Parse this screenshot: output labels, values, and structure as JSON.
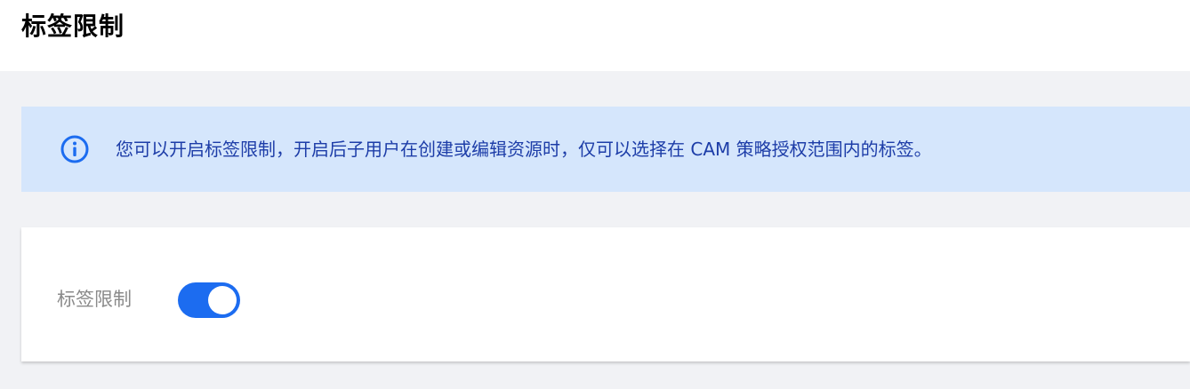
{
  "header": {
    "title": "标签限制"
  },
  "notice": {
    "icon": "info-icon",
    "text": "您可以开启标签限制，开启后子用户在创建或编辑资源时，仅可以选择在 CAM 策略授权范围内的标签。",
    "color": "#1d3da8",
    "background": "#d5e6fc"
  },
  "setting": {
    "label": "标签限制",
    "toggle_on": true,
    "toggle_color": "#1c6cf0"
  }
}
